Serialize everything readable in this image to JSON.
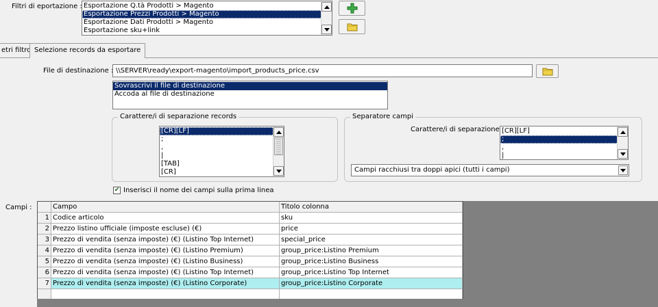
{
  "filters": {
    "label": "Filtri di eportazione :",
    "items": [
      "Esportazione Q.tà Prodotti > Magento",
      "Esportazione Prezzi Prodotti > Magento",
      "Esportazione Dati Prodotti > Magento",
      "Esportazione sku+link"
    ],
    "selected_index": 1
  },
  "tabs": [
    {
      "label": "etri filtro",
      "active": false
    },
    {
      "label": "Selezione records da esportare",
      "active": true
    }
  ],
  "destination": {
    "label": "File di destinazione :",
    "value": "\\\\SERVER\\ready\\export-magento\\import_products_price.csv"
  },
  "write_mode": {
    "items": [
      "Sovrascrivi il file di destinazione",
      "Accoda al file di destinazione"
    ],
    "selected_index": 0
  },
  "record_separator": {
    "title": "Carattere/i di separazione records",
    "items": [
      "[CR][LF]",
      ";",
      ",",
      "|",
      "[TAB]",
      "[CR]"
    ],
    "selected_index": 0
  },
  "field_separator": {
    "title": "Separatore campi",
    "label": "Carattere/i di separazione :",
    "items": [
      "[CR][LF]",
      ";",
      ",",
      "|"
    ],
    "selected_index": 1,
    "quote_option": "Campi racchiusi tra doppi apici (tutti i campi)"
  },
  "header_checkbox": {
    "label": "Inserisci il nome dei campi sulla prima linea",
    "checked": true
  },
  "fields": {
    "label": "Campi :",
    "columns": [
      "Campo",
      "Titolo colonna"
    ],
    "rows": [
      {
        "n": "1",
        "campo": "Codice articolo",
        "titolo": "sku"
      },
      {
        "n": "2",
        "campo": "Prezzo listino ufficiale (imposte escluse) (€)",
        "titolo": "price"
      },
      {
        "n": "3",
        "campo": "Prezzo di vendita (senza imposte) (€) (Listino Top Internet)",
        "titolo": "special_price"
      },
      {
        "n": "4",
        "campo": "Prezzo di vendita (senza imposte) (€) (Listino Premium)",
        "titolo": "group_price:Listino Premium"
      },
      {
        "n": "5",
        "campo": "Prezzo di vendita (senza imposte) (€) (Listino Business)",
        "titolo": "group_price:Listino Business"
      },
      {
        "n": "6",
        "campo": "Prezzo di vendita (senza imposte) (€) (Listino Top Internet)",
        "titolo": "group_price:Listino Top Internet"
      },
      {
        "n": "7",
        "campo": "Prezzo di vendita (senza imposte) (€) (Listino Corporate)",
        "titolo": "group_price:Listino Corporate"
      }
    ],
    "highlight_index": 6
  },
  "colors": {
    "selection": "#0b2a6b",
    "row_highlight": "#aeeef0",
    "add_icon": "#3cb043",
    "folder_icon": "#f0d24a"
  },
  "icons": {
    "add": "plus-icon",
    "open": "folder-icon"
  }
}
